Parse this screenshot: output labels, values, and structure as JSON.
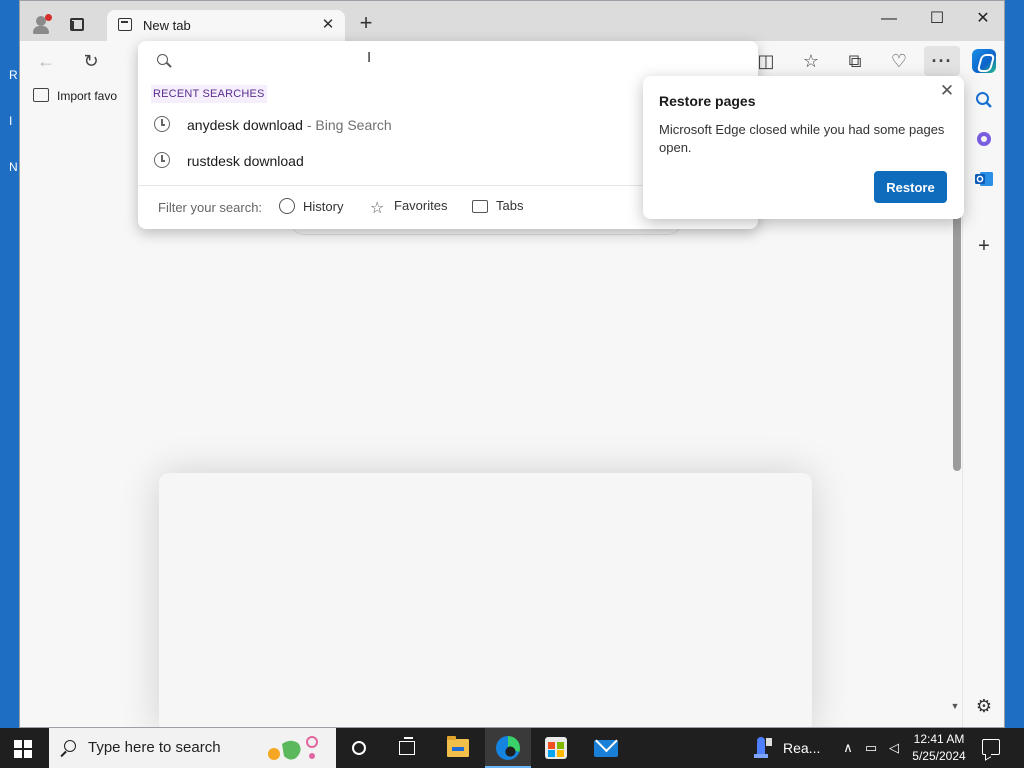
{
  "desktop": {
    "icon_letters": [
      "R",
      "I",
      "N"
    ]
  },
  "browser": {
    "tab": {
      "title": "New tab"
    },
    "favorites_bar": {
      "import_label": "Import favo"
    },
    "omnibox": {
      "input_value": "",
      "recent_header": "RECENT SEARCHES",
      "suggestions": [
        {
          "text": "anydesk download",
          "suffix": "- Bing Search"
        },
        {
          "text": "rustdesk download",
          "suffix": ""
        }
      ],
      "filter_label": "Filter your search:",
      "filters": [
        "History",
        "Favorites",
        "Tabs"
      ]
    },
    "restore_popup": {
      "title": "Restore pages",
      "message": "Microsoft Edge closed while you had some pages open.",
      "button": "Restore",
      "accent_color": "#0f6cbd"
    }
  },
  "taskbar": {
    "search_placeholder": "Type here to search",
    "ready_app_label": "Rea...",
    "clock": {
      "time": "12:41 AM",
      "date": "5/25/2024"
    }
  },
  "icons": {
    "toolbar": [
      "back-icon",
      "refresh-icon",
      "split-screen-icon",
      "favorites-icon",
      "collections-icon",
      "browser-essentials-icon",
      "more-icon",
      "copilot-icon"
    ],
    "sidebar": [
      "search-icon",
      "copilot-apps-icon",
      "outlook-icon",
      "add-icon",
      "settings-icon"
    ]
  }
}
